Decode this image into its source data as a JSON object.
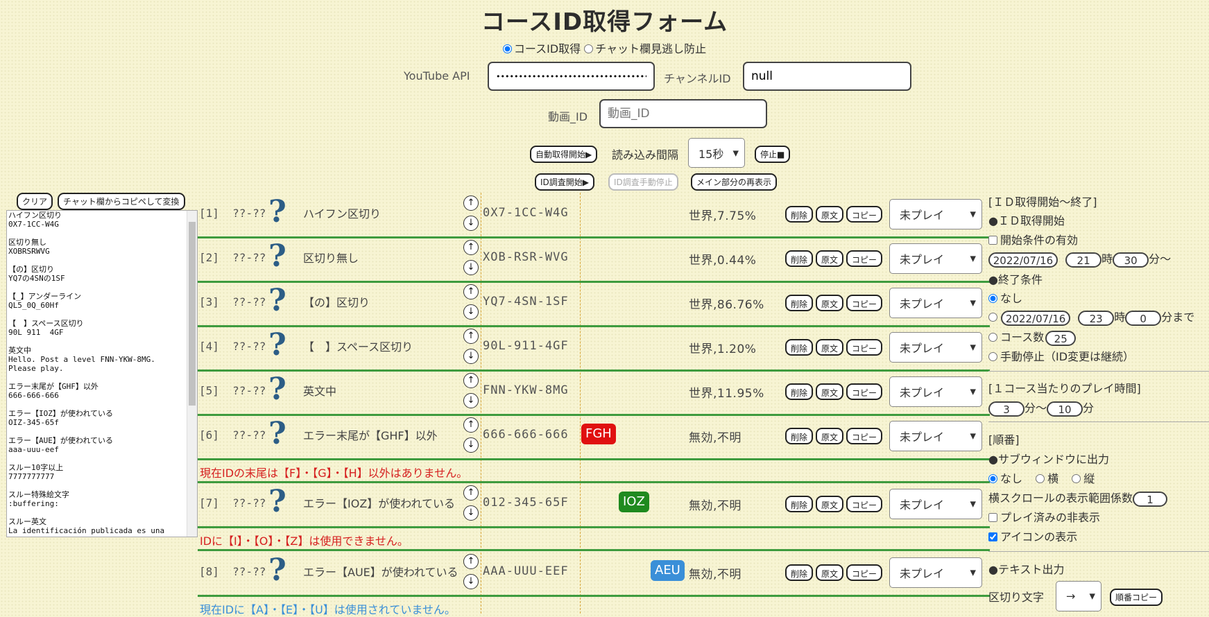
{
  "title": "コースID取得フォーム",
  "modes": {
    "mode1": "コースID取得",
    "mode2": "チャット欄見逃し防止"
  },
  "api": {
    "label": "YouTube API",
    "value": "•••••••••••••••••••••••••••••••••••••"
  },
  "channel": {
    "label": "チャンネルID",
    "value": "null"
  },
  "video": {
    "label": "動画_ID",
    "placeholder": "動画_ID"
  },
  "controls": {
    "auto_start": "自動取得開始▶",
    "interval_label": "読み込み間隔",
    "interval_value": "15秒",
    "stop": "停止■",
    "adjust_start": "ID調査開始▶",
    "adjust_stop": "ID調査手動停止",
    "redisplay": "メイン部分の再表示"
  },
  "left": {
    "clear": "クリア",
    "convert": "チャット欄からコピペして変換",
    "textarea_lines": [
      "ハイフン区切り",
      "0X7-1CC-W4G",
      "",
      "区切り無し",
      "XOBRSRWVG",
      "",
      "【の】区切り",
      "YQ7の4SNの1SF",
      "",
      "【_】アンダーライン",
      "QL5_0Q_60Hf",
      "",
      "【　】スペース区切り",
      "90L 911  4GF",
      "",
      "英文中",
      "Hello. Post a level FNN-YKW-8MG.",
      "Please play.",
      "",
      "エラー末尾が【GHF】以外",
      "666-666-666",
      "",
      "エラー【IOZ】が使われている",
      "OIZ-345-65f",
      "",
      "エラー【AUE】が使われている",
      "aaa-uuu-eef",
      "",
      "スルー10字以上",
      "7777777777",
      "",
      "スルー特殊絵文字",
      ":buffering:",
      "",
      "スルー英文",
      "La identificación publicada es una"
    ]
  },
  "rows": [
    {
      "num": "[1]",
      "range": "??-??",
      "name": "ハイフン区切り",
      "id": "0X7-1CC-W4G",
      "result": "世界,7.75%",
      "status": "未プレイ"
    },
    {
      "num": "[2]",
      "range": "??-??",
      "name": "区切り無し",
      "id": "XOB-RSR-WVG",
      "result": "世界,0.44%",
      "status": "未プレイ"
    },
    {
      "num": "[3]",
      "range": "??-??",
      "name": "【の】区切り",
      "id": "YQ7-4SN-1SF",
      "result": "世界,86.76%",
      "status": "未プレイ"
    },
    {
      "num": "[4]",
      "range": "??-??",
      "name": "【　】スペース区切り",
      "id": "90L-911-4GF",
      "result": "世界,1.20%",
      "status": "未プレイ"
    },
    {
      "num": "[5]",
      "range": "??-??",
      "name": "英文中",
      "id": "FNN-YKW-8MG",
      "result": "世界,11.95%",
      "status": "未プレイ"
    },
    {
      "num": "[6]",
      "range": "??-??",
      "name": "エラー末尾が【GHF】以外",
      "id": "666-666-666",
      "badge": "FGH",
      "result": "無効,不明",
      "status": "未プレイ",
      "msg": "現在IDの末尾は【F】・【G】・【H】以外はありません。"
    },
    {
      "num": "[7]",
      "range": "??-??",
      "name": "エラー【IOZ】が使われている",
      "id": "012-345-65F",
      "badge": "IOZ",
      "result": "無効,不明",
      "status": "未プレイ",
      "msg": "IDに【I】・【O】・【Z】は使用できません。"
    },
    {
      "num": "[8]",
      "range": "??-??",
      "name": "エラー【AUE】が使われている",
      "id": "AAA-UUU-EEF",
      "badge": "AEU",
      "result": "無効,不明",
      "status": "未プレイ",
      "msg": "現在IDに【A】・【E】・【U】は使用されていません。"
    }
  ],
  "row_buttons": {
    "delete": "削除",
    "original": "原文",
    "copy": "コピー",
    "up": "↑",
    "down": "↓"
  },
  "colors": {
    "green": "#3e9b3e",
    "red_badge": "#e01010",
    "green_badge": "#1f8a1f",
    "blue_badge": "#3a8fd8",
    "red_msg": "#d62020",
    "blue_msg": "#3a8fd8"
  },
  "right": {
    "section1": "[ＩＤ取得開始～終了]",
    "start_head": "●ＩＤ取得開始",
    "start_cond": "開始条件の有効",
    "start_date": "2022/07/16",
    "start_hour": "21",
    "hour_unit": "時",
    "start_min": "30",
    "start_min_unit": "分～",
    "end_head": "●終了条件",
    "end_none": "なし",
    "end_date": "2022/07/16",
    "end_hour": "23",
    "end_min": "0",
    "end_min_unit": "分まで",
    "course_count_label": "コース数",
    "course_count": "25",
    "manual_stop": "手動停止（ID変更は継続）",
    "section2": "[１コース当たりのプレイ時間]",
    "play_min": "3",
    "play_from_unit": "分～",
    "play_max": "10",
    "play_to_unit": "分",
    "section3": "[順番]",
    "sub_head": "●サブウィンドウに出力",
    "sub_none": "なし",
    "sub_h": "横",
    "sub_v": "縦",
    "scroll_label": "横スクロールの表示範囲係数",
    "scroll_value": "1",
    "hide_played": "プレイ済みの非表示",
    "show_icon": "アイコンの表示",
    "text_head": "●テキスト出力",
    "sep_label": "区切り文字",
    "sep_value": "→",
    "order_copy": "順番コピー"
  }
}
